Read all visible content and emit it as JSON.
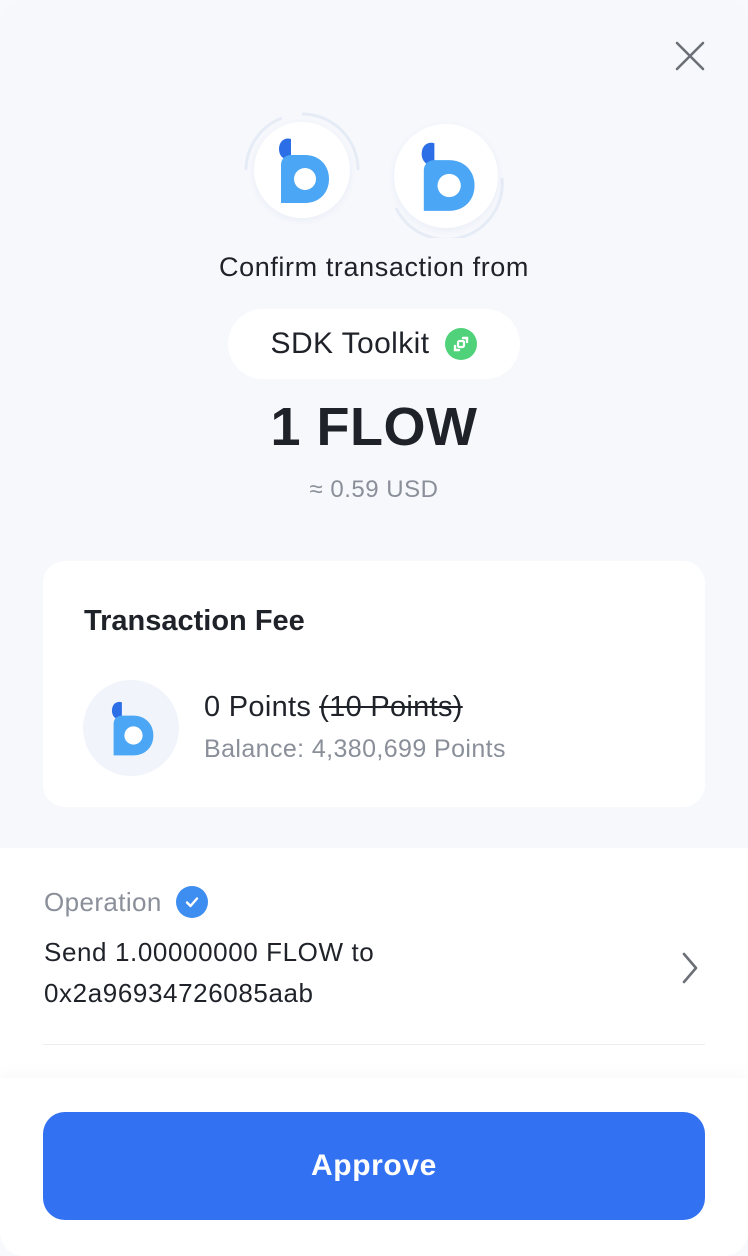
{
  "header": {
    "close_icon": "close-icon",
    "confirm_text": "Confirm transaction from",
    "app_name": "SDK Toolkit",
    "app_badge_icon": "flow-link-icon"
  },
  "amount": {
    "value": "1 FLOW",
    "usd": "≈ 0.59 USD"
  },
  "fee": {
    "title": "Transaction Fee",
    "points": "0 Points",
    "original_points": "(10 Points)",
    "balance": "Balance: 4,380,699 Points"
  },
  "operation": {
    "label": "Operation",
    "verified_icon": "check-badge-icon",
    "description_line1": "Send 1.00000000 FLOW to",
    "description_line2": "0x2a96934726085aab",
    "chevron_icon": "chevron-right-icon"
  },
  "footer": {
    "approve_label": "Approve"
  },
  "colors": {
    "primary": "#3271f1",
    "logo_blue_dark": "#2c6ee6",
    "logo_blue_light": "#4ba6f5",
    "flow_green": "#4fd27a",
    "muted_text": "#8a8f99",
    "background": "#f6f8fc"
  }
}
